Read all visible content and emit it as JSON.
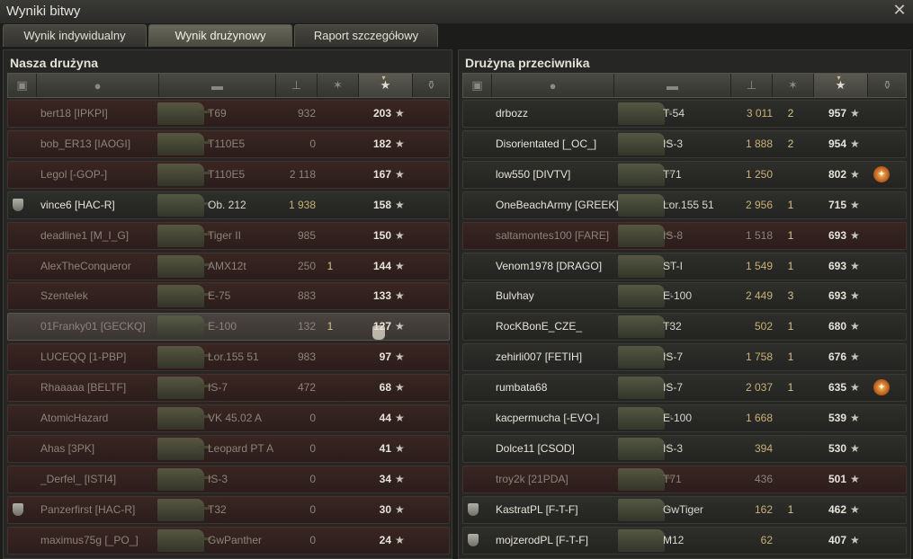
{
  "window": {
    "title": "Wyniki bitwy"
  },
  "tabs": [
    "Wynik indywidualny",
    "Wynik drużynowy",
    "Raport szczegółowy"
  ],
  "active_tab": 1,
  "columns": {
    "sort_marker": "▾"
  },
  "our_team": {
    "title": "Nasza drużyna",
    "rows": [
      {
        "player": "bert18 [IPKPI]",
        "tank": "T69",
        "damage": "932",
        "kills": "",
        "xp": "203",
        "dead": true,
        "medal": false,
        "squad": false
      },
      {
        "player": "bob_ER13 [IAOGI]",
        "tank": "T110E5",
        "damage": "0",
        "kills": "",
        "xp": "182",
        "dead": true,
        "medal": false,
        "squad": false
      },
      {
        "player": "Legol [-GOP-]",
        "tank": "T110E5",
        "damage": "2 118",
        "kills": "",
        "xp": "167",
        "dead": true,
        "medal": false,
        "squad": false
      },
      {
        "player": "vince6 [HAC-R]",
        "tank": "Ob. 212",
        "damage": "1 938",
        "kills": "",
        "xp": "158",
        "dead": false,
        "medal": false,
        "squad": true
      },
      {
        "player": "deadline1 [M_I_G]",
        "tank": "Tiger II",
        "damage": "985",
        "kills": "",
        "xp": "150",
        "dead": true,
        "medal": false,
        "squad": false
      },
      {
        "player": "AlexTheConqueror",
        "tank": "AMX12t",
        "damage": "250",
        "kills": "1",
        "xp": "144",
        "dead": true,
        "medal": false,
        "squad": false
      },
      {
        "player": "Szentelek",
        "tank": "E-75",
        "damage": "883",
        "kills": "",
        "xp": "133",
        "dead": true,
        "medal": false,
        "squad": false
      },
      {
        "player": "01Franky01 [GECKQ]",
        "tank": "E-100",
        "damage": "132",
        "kills": "1",
        "xp": "127",
        "dead": true,
        "medal": false,
        "squad": false,
        "highlight": true
      },
      {
        "player": "LUCEQQ [1-PBP]",
        "tank": "Lor.155 51",
        "damage": "983",
        "kills": "",
        "xp": "97",
        "dead": true,
        "medal": false,
        "squad": false
      },
      {
        "player": "Rhaaaaa [BELTF]",
        "tank": "IS-7",
        "damage": "472",
        "kills": "",
        "xp": "68",
        "dead": true,
        "medal": false,
        "squad": false
      },
      {
        "player": "AtomicHazard",
        "tank": "VK 45.02 A",
        "damage": "0",
        "kills": "",
        "xp": "44",
        "dead": true,
        "medal": false,
        "squad": false
      },
      {
        "player": "Ahas [3PK]",
        "tank": "Leopard PT A",
        "damage": "0",
        "kills": "",
        "xp": "41",
        "dead": true,
        "medal": false,
        "squad": false
      },
      {
        "player": "_Derfel_ [ISTI4]",
        "tank": "IS-3",
        "damage": "0",
        "kills": "",
        "xp": "34",
        "dead": true,
        "medal": false,
        "squad": false
      },
      {
        "player": "Panzerfirst [HAC-R]",
        "tank": "T32",
        "damage": "0",
        "kills": "",
        "xp": "30",
        "dead": true,
        "medal": false,
        "squad": true
      },
      {
        "player": "maximus75g [_PO_]",
        "tank": "GwPanther",
        "damage": "0",
        "kills": "",
        "xp": "24",
        "dead": true,
        "medal": false,
        "squad": false
      }
    ]
  },
  "enemy_team": {
    "title": "Drużyna przeciwnika",
    "rows": [
      {
        "player": "drbozz",
        "tank": "T-54",
        "damage": "3 011",
        "kills": "2",
        "xp": "957",
        "dead": false,
        "medal": false,
        "squad": false
      },
      {
        "player": "Disorientated [_OC_]",
        "tank": "IS-3",
        "damage": "1 888",
        "kills": "2",
        "xp": "954",
        "dead": false,
        "medal": false,
        "squad": false
      },
      {
        "player": "low550 [DIVTV]",
        "tank": "T71",
        "damage": "1 250",
        "kills": "",
        "xp": "802",
        "dead": false,
        "medal": true,
        "squad": false
      },
      {
        "player": "OneBeachArmy [GREEK]",
        "tank": "Lor.155 51",
        "damage": "2 956",
        "kills": "1",
        "xp": "715",
        "dead": false,
        "medal": false,
        "squad": false
      },
      {
        "player": "saltamontes100 [FARE]",
        "tank": "IS-8",
        "damage": "1 518",
        "kills": "1",
        "xp": "693",
        "dead": true,
        "medal": false,
        "squad": false
      },
      {
        "player": "Venom1978 [DRAGO]",
        "tank": "ST-I",
        "damage": "1 549",
        "kills": "1",
        "xp": "693",
        "dead": false,
        "medal": false,
        "squad": false
      },
      {
        "player": "Bulvhay",
        "tank": "E-100",
        "damage": "2 449",
        "kills": "3",
        "xp": "693",
        "dead": false,
        "medal": false,
        "squad": false
      },
      {
        "player": "RocKBonE_CZE_",
        "tank": "T32",
        "damage": "502",
        "kills": "1",
        "xp": "680",
        "dead": false,
        "medal": false,
        "squad": false
      },
      {
        "player": "zehirli007 [FETIH]",
        "tank": "IS-7",
        "damage": "1 758",
        "kills": "1",
        "xp": "676",
        "dead": false,
        "medal": false,
        "squad": false
      },
      {
        "player": "rumbata68",
        "tank": "IS-7",
        "damage": "2 037",
        "kills": "1",
        "xp": "635",
        "dead": false,
        "medal": true,
        "squad": false
      },
      {
        "player": "kacpermucha [-EVO-]",
        "tank": "E-100",
        "damage": "1 668",
        "kills": "",
        "xp": "539",
        "dead": false,
        "medal": false,
        "squad": false
      },
      {
        "player": "Dolce11 [CSOD]",
        "tank": "IS-3",
        "damage": "394",
        "kills": "",
        "xp": "530",
        "dead": false,
        "medal": false,
        "squad": false
      },
      {
        "player": "troy2k [21PDA]",
        "tank": "T71",
        "damage": "436",
        "kills": "",
        "xp": "501",
        "dead": true,
        "medal": false,
        "squad": false
      },
      {
        "player": "KastratPL [F-T-F]",
        "tank": "GwTiger",
        "damage": "162",
        "kills": "1",
        "xp": "462",
        "dead": false,
        "medal": false,
        "squad": true
      },
      {
        "player": "mojzerodPL [F-T-F]",
        "tank": "M12",
        "damage": "62",
        "kills": "",
        "xp": "407",
        "dead": false,
        "medal": false,
        "squad": true
      }
    ]
  },
  "icons": {
    "close": "close-icon",
    "star": "★",
    "medal": "✦"
  }
}
